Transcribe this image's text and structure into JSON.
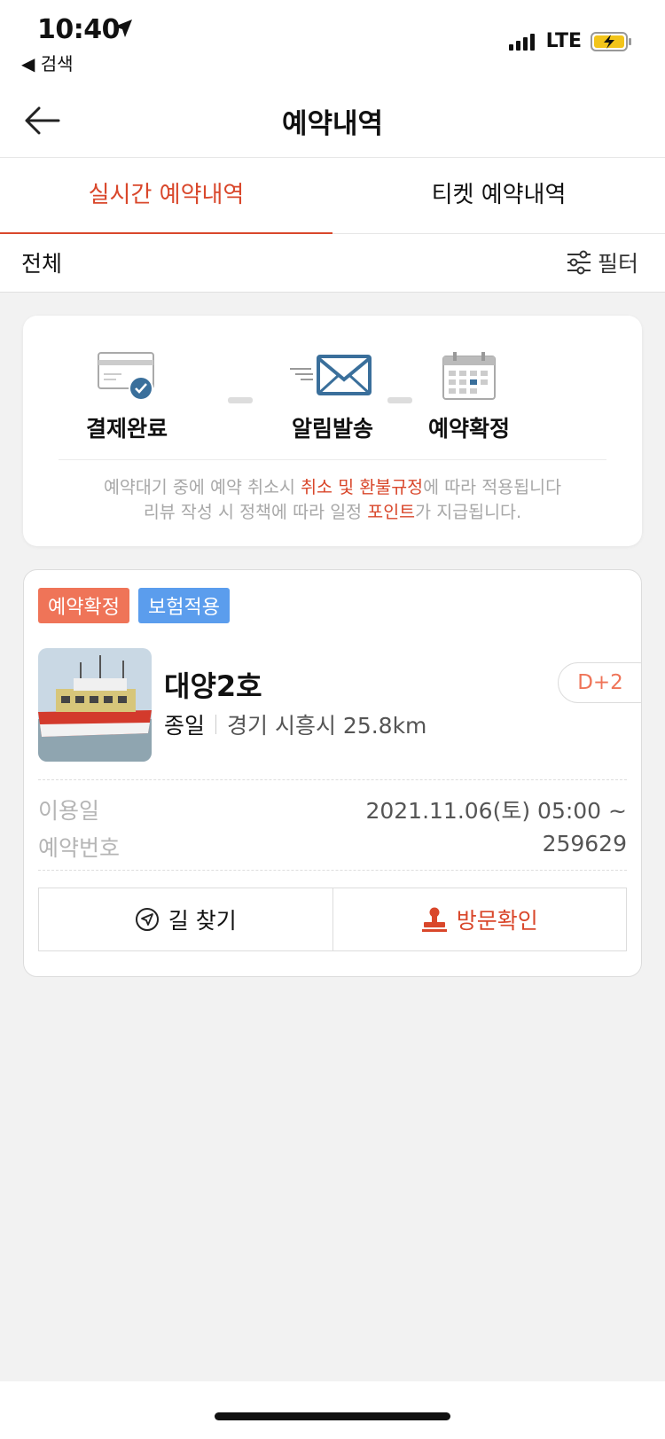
{
  "status_bar": {
    "time": "10:40",
    "back_app": "◀ 검색",
    "network": "LTE"
  },
  "nav": {
    "title": "예약내역"
  },
  "tabs": [
    {
      "label": "실시간 예약내역",
      "active": true
    },
    {
      "label": "티켓 예약내역",
      "active": false
    }
  ],
  "filter": {
    "scope": "전체",
    "button_label": "필터"
  },
  "steps": {
    "items": [
      {
        "label": "결제완료",
        "icon": "card-check-icon"
      },
      {
        "label": "알림발송",
        "icon": "envelope-icon"
      },
      {
        "label": "예약확정",
        "icon": "calendar-icon"
      }
    ],
    "notice_line1": {
      "pre": "예약대기 중에 예약 취소시 ",
      "highlight": "취소 및 환불규정",
      "post": "에 따라 적용됩니다"
    },
    "notice_line2": {
      "pre": "리뷰 작성 시 정책에 따라 일정 ",
      "highlight": "포인트",
      "post": "가 지급됩니다."
    }
  },
  "reservation": {
    "badges": [
      {
        "label": "예약확정",
        "color": "#ef7458"
      },
      {
        "label": "보험적용",
        "color": "#5b9ded"
      }
    ],
    "ship_name": "대양2호",
    "trip_type": "종일",
    "location": "경기 시흥시 25.8km",
    "dday": "D+2",
    "use_date_label": "이용일",
    "use_date_value": "2021.11.06(토) 05:00 ~",
    "reservation_no_label": "예약번호",
    "reservation_no_value": "259629",
    "directions_label": "길 찾기",
    "visit_label": "방문확인"
  },
  "colors": {
    "accent": "#d9472b",
    "confirmed_badge": "#ef7458",
    "insured_badge": "#5b9ded",
    "icon_blue": "#3a6f9b"
  }
}
